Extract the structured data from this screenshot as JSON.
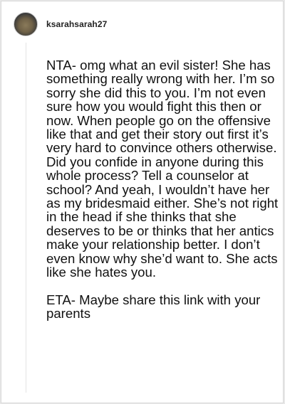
{
  "comment": {
    "username": "ksarahsarah27",
    "paragraphs": [
      "NTA- omg what an evil sister! She has something really wrong with her. I’m so sorry she did this to you. I’m not even sure how you would fight this then or now. When people go on the offensive like that and get their story out first it’s very hard to convince others otherwise. Did you confide in anyone during this whole process? Tell a counselor at school? And yeah, I wouldn’t have her as my bridesmaid either. She’s not right in the head if she thinks that she deserves to be or thinks that her antics make your relationship better. I don’t even know why she’d want to. She acts like she hates you.",
      "ETA- Maybe share this link with your parents"
    ]
  }
}
